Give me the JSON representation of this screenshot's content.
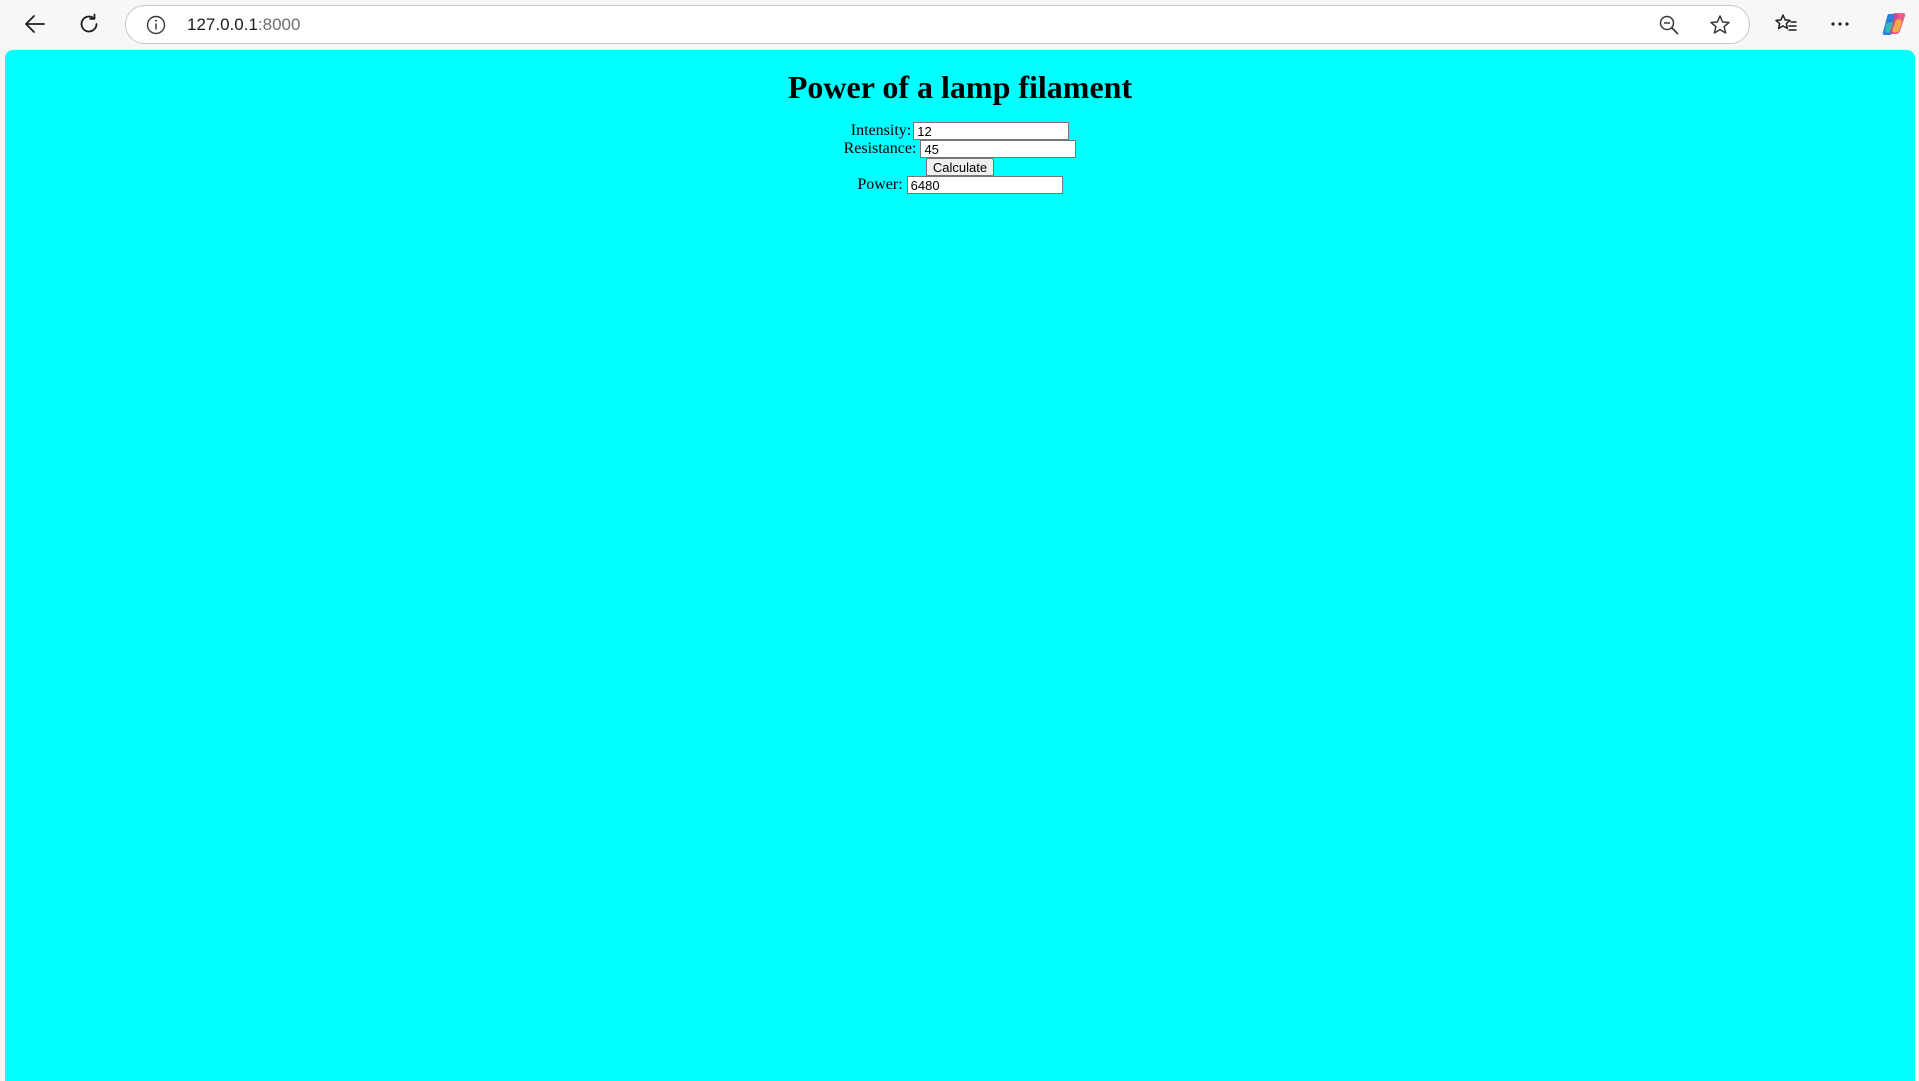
{
  "browser": {
    "url_host": "127.0.0.1",
    "url_port": ":8000"
  },
  "page": {
    "title": "Power of a lamp filament",
    "background_color": "#00ffff"
  },
  "form": {
    "intensity_label": "Intensity:",
    "intensity_value": "12",
    "resistance_label": "Resistance:",
    "resistance_value": "45",
    "calculate_label": "Calculate",
    "power_label": "Power:",
    "power_value": "6480"
  },
  "icons": {
    "back": "back-arrow-icon",
    "reload": "reload-icon",
    "site_info": "info-icon",
    "zoom": "zoom-out-icon",
    "favorite": "star-icon",
    "favorites_list": "favorites-icon",
    "more": "more-icon",
    "copilot": "copilot-icon"
  }
}
